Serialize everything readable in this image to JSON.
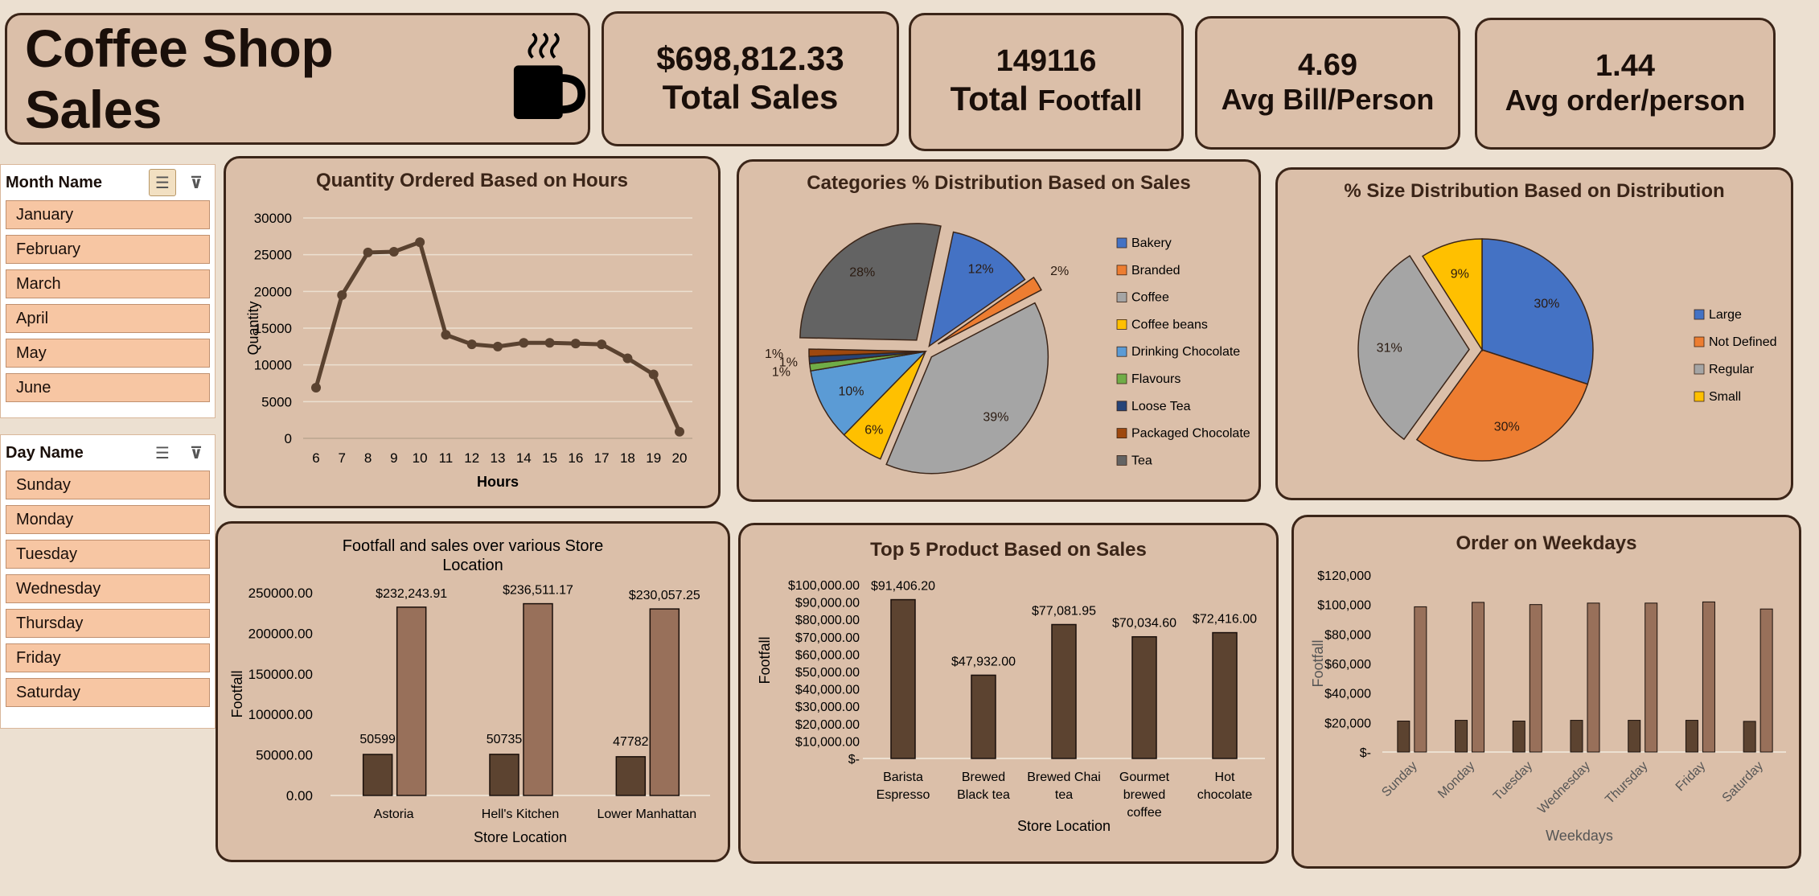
{
  "header": {
    "title": "Coffee Shop Sales"
  },
  "kpis": {
    "total_sales_value": "$698,812.33",
    "total_sales_label": "Total Sales",
    "footfall_value": "149116",
    "footfall_label_a": "Total",
    "footfall_label_b": "Footfall",
    "avg_bill_value": "4.69",
    "avg_bill_label": "Avg Bill/Person",
    "avg_order_value": "1.44",
    "avg_order_label": "Avg order/person"
  },
  "slicers": {
    "month": {
      "title": "Month Name",
      "items": [
        "January",
        "February",
        "March",
        "April",
        "May",
        "June"
      ]
    },
    "day": {
      "title": "Day Name",
      "items": [
        "Sunday",
        "Monday",
        "Tuesday",
        "Wednesday",
        "Thursday",
        "Friday",
        "Saturday"
      ]
    }
  },
  "colors": {
    "dark_bar": "#5c4330",
    "light_bar": "#98705a",
    "line": "#5a4230"
  },
  "chart_data": [
    {
      "type": "line",
      "title": "Quantity Ordered Based on Hours",
      "xlabel": "Hours",
      "ylabel": "Quantity",
      "x": [
        6,
        7,
        8,
        9,
        10,
        11,
        12,
        13,
        14,
        15,
        16,
        17,
        18,
        19,
        20
      ],
      "y": [
        6900,
        19500,
        25300,
        25400,
        26700,
        14100,
        12800,
        12500,
        13000,
        13000,
        12900,
        12800,
        10900,
        8700,
        900
      ],
      "ylim": [
        0,
        30000
      ],
      "yticks": [
        0,
        5000,
        10000,
        15000,
        20000,
        25000,
        30000
      ],
      "grid": true
    },
    {
      "type": "pie",
      "title": "Categories % Distribution Based on Sales",
      "labels": [
        "Bakery",
        "Branded",
        "Coffee",
        "Coffee beans",
        "Drinking Chocolate",
        "Flavours",
        "Loose Tea",
        "Packaged Chocolate",
        "Tea"
      ],
      "values": [
        12,
        2,
        39,
        6,
        10,
        1,
        1,
        1,
        28
      ],
      "value_labels": [
        "12%",
        "2%",
        "39%",
        "6%",
        "10%",
        "1%",
        "1%",
        "1%",
        "28%"
      ],
      "colors": [
        "#4472c4",
        "#ed7d31",
        "#a5a5a5",
        "#ffc000",
        "#5b9bd5",
        "#70ad47",
        "#264478",
        "#9e480e",
        "#636363"
      ],
      "legend": "right"
    },
    {
      "type": "pie",
      "title": "% Size Distribution Based on Distribution",
      "labels": [
        "Large",
        "Not Defined",
        "Regular",
        "Small"
      ],
      "values": [
        30,
        30,
        31,
        9
      ],
      "value_labels": [
        "30%",
        "30%",
        "31%",
        "9%"
      ],
      "colors": [
        "#4472c4",
        "#ed7d31",
        "#a5a5a5",
        "#ffc000"
      ],
      "legend": "right"
    },
    {
      "type": "bar",
      "title": "Footfall and sales over various Store Location",
      "xlabel": "Store Location",
      "ylabel": "Footfall",
      "categories": [
        "Astoria",
        "Hell's Kitchen",
        "Lower Manhattan"
      ],
      "series": [
        {
          "values": [
            50599,
            50735,
            47782
          ],
          "labels": [
            "50599",
            "50735",
            "47782"
          ]
        },
        {
          "values": [
            232243.91,
            236511.17,
            230057.25
          ],
          "labels": [
            "$232,243.91",
            "$236,511.17",
            "$230,057.25"
          ]
        }
      ],
      "ylim": [
        0,
        250000
      ],
      "yticks": [
        "0.00",
        "50000.00",
        "100000.00",
        "150000.00",
        "200000.00",
        "250000.00"
      ]
    },
    {
      "type": "bar",
      "title": "Top 5 Product Based on Sales",
      "xlabel": "Store Location",
      "ylabel": "Footfall",
      "categories": [
        [
          "Barista",
          "Espresso"
        ],
        [
          "Brewed",
          "Black tea"
        ],
        [
          "Brewed Chai",
          "tea"
        ],
        [
          "Gourmet",
          "brewed",
          "coffee"
        ],
        [
          "Hot",
          "chocolate"
        ]
      ],
      "values": [
        91406.2,
        47932.0,
        77081.95,
        70034.6,
        72416.0
      ],
      "value_labels": [
        "$91,406.20",
        "$47,932.00",
        "$77,081.95",
        "$70,034.60",
        "$72,416.00"
      ],
      "ylim": [
        0,
        100000
      ],
      "yticks": [
        "$-",
        "$10,000.00",
        "$20,000.00",
        "$30,000.00",
        "$40,000.00",
        "$50,000.00",
        "$60,000.00",
        "$70,000.00",
        "$80,000.00",
        "$90,000.00",
        "$100,000.00"
      ]
    },
    {
      "type": "bar",
      "title": "Order on Weekdays",
      "xlabel": "Weekdays",
      "ylabel": "Footfall",
      "categories": [
        "Sunday",
        "Monday",
        "Tuesday",
        "Wednesday",
        "Thursday",
        "Friday",
        "Saturday"
      ],
      "series": [
        {
          "values": [
            21000,
            21500,
            21000,
            21500,
            21500,
            21500,
            20800
          ]
        },
        {
          "values": [
            98500,
            101500,
            100000,
            101000,
            101000,
            101800,
            97000
          ]
        }
      ],
      "ylim": [
        0,
        120000
      ],
      "yticks": [
        "$-",
        "$20,000",
        "$40,000",
        "$60,000",
        "$80,000",
        "$100,000",
        "$120,000"
      ]
    }
  ]
}
